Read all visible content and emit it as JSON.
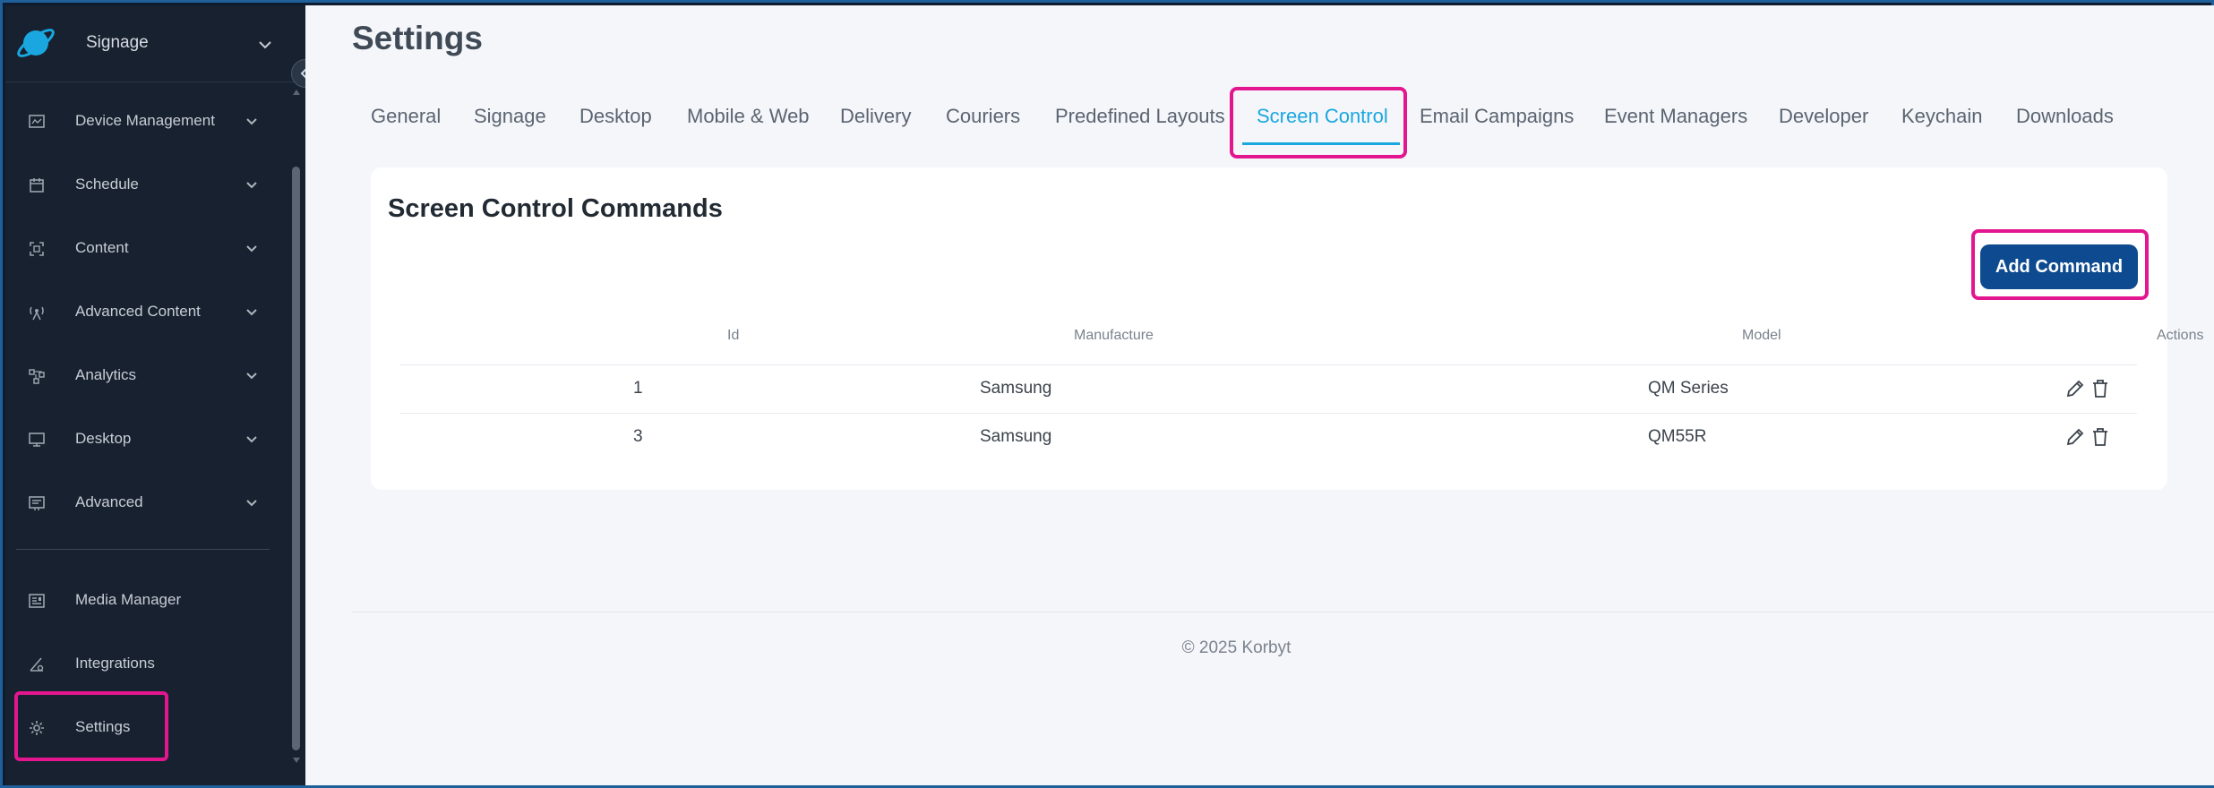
{
  "sidebar": {
    "brand": "Signage",
    "items": [
      {
        "label": "Device Management",
        "icon": "device-management-icon"
      },
      {
        "label": "Schedule",
        "icon": "calendar-icon"
      },
      {
        "label": "Content",
        "icon": "content-icon"
      },
      {
        "label": "Advanced Content",
        "icon": "broadcast-icon"
      },
      {
        "label": "Analytics",
        "icon": "analytics-icon"
      },
      {
        "label": "Desktop",
        "icon": "monitor-icon"
      },
      {
        "label": "Advanced",
        "icon": "advanced-icon"
      }
    ],
    "bottom_items": [
      {
        "label": "Media Manager",
        "icon": "media-manager-icon"
      },
      {
        "label": "Integrations",
        "icon": "integrations-icon"
      },
      {
        "label": "Settings",
        "icon": "gear-icon"
      }
    ]
  },
  "page": {
    "title": "Settings",
    "tabs": [
      "General",
      "Signage",
      "Desktop",
      "Mobile & Web",
      "Delivery",
      "Couriers",
      "Predefined Layouts",
      "Screen Control",
      "Email Campaigns",
      "Event Managers",
      "Developer",
      "Keychain",
      "Downloads"
    ],
    "active_tab": "Screen Control"
  },
  "card": {
    "title": "Screen Control Commands",
    "add_button": "Add Command",
    "table": {
      "columns": [
        "Id",
        "Manufacture",
        "Model",
        "Actions"
      ],
      "rows": [
        {
          "id": "1",
          "manufacture": "Samsung",
          "model": "QM Series"
        },
        {
          "id": "3",
          "manufacture": "Samsung",
          "model": "QM55R"
        }
      ]
    }
  },
  "footer": "© 2025 Korbyt",
  "colors": {
    "accent": "#1aa7e0",
    "primary_button": "#0d4a8f",
    "highlight": "#e3168f",
    "sidebar_bg": "#17212f"
  }
}
